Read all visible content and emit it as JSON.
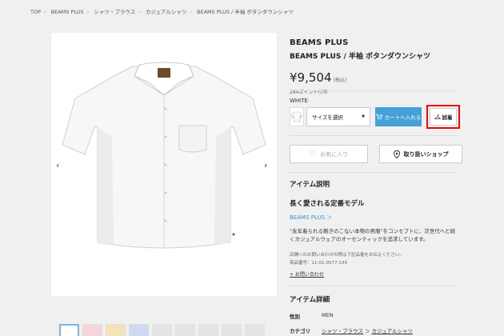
{
  "breadcrumb": [
    "TOP",
    "BEAMS PLUS",
    "シャツ・ブラウス",
    "カジュアルシャツ",
    "BEAMS PLUS / 半袖 ボタンダウンシャツ"
  ],
  "product": {
    "brand": "BEAMS PLUS",
    "name": "BEAMS PLUS / 半袖 ボタンダウンシャツ",
    "price": "¥9,504",
    "tax_note": "(税込)",
    "points": "264ポイント付与",
    "color": "WHITE"
  },
  "controls": {
    "size_select": "サイズを選択",
    "cart_button": "カートへ入れる",
    "tryon_button": "試着",
    "favorite_button": "お気に入り",
    "shop_button": "取り扱いショップ"
  },
  "description": {
    "section_title": "アイテム説明",
    "heading": "長く愛される定番モデル",
    "brand_link": "BEAMS PLUS ＞",
    "body": "\"永年着られる飽きのこない本物の男服\"をコンセプトに、次世代へと続くカジュアルウェアのオーセンティックを追求しています。",
    "note_line1": "店舗へのお問い合わせの際は下記品番をお伝えください。",
    "note_line2": "商品番号：11-01-0577-139",
    "inquiry_link": "+ お問い合わせ"
  },
  "details": {
    "section_title": "アイテム詳細",
    "gender_label": "性別",
    "gender_value": "MEN",
    "category_label": "カテゴリ",
    "category_value_1": "シャツ・ブラウス",
    "category_value_2": "カジュアルシャツ"
  },
  "icons": {
    "prev": "chevron-left-icon",
    "next": "chevron-right-icon",
    "cart": "cart-icon",
    "tryon": "hanger-icon",
    "favorite": "heart-icon",
    "shop": "location-pin-icon"
  },
  "colors": {
    "accent": "#45a1d8",
    "highlight": "#e00000",
    "link": "#3a8fd0"
  }
}
